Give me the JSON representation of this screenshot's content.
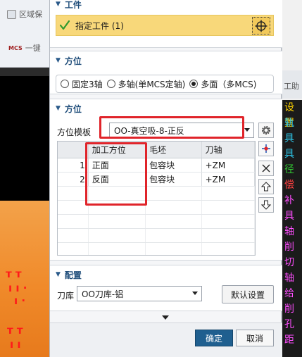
{
  "background": {
    "toolbar_item_1": "区域保",
    "toolbar_item_2_tag": "MCS",
    "toolbar_item_2": "一键",
    "right_tab": "工助",
    "right_list": [
      {
        "text": "设置",
        "color": "#ffd400"
      },
      {
        "text": "轨",
        "color": "#2ec4e6"
      },
      {
        "text": "具",
        "color": "#2ec4e6"
      },
      {
        "text": "具",
        "color": "#2ec4e6"
      },
      {
        "text": "径",
        "color": "#33cc33"
      },
      {
        "text": "偿",
        "color": "#ff4040"
      },
      {
        "text": "补",
        "color": "#ff4dff"
      },
      {
        "text": "具",
        "color": "#ff4dff"
      },
      {
        "text": "轴",
        "color": "#ff4dff"
      },
      {
        "text": "削",
        "color": "#ff4dff"
      },
      {
        "text": "切",
        "color": "#ff4dff"
      },
      {
        "text": "轴",
        "color": "#ff4dff"
      },
      {
        "text": "给",
        "color": "#ff4dff"
      },
      {
        "text": "削",
        "color": "#ff4dff"
      },
      {
        "text": "孔",
        "color": "#ff4dff"
      },
      {
        "text": "距",
        "color": "#ff4dff"
      }
    ]
  },
  "dialog": {
    "workpiece_section": {
      "title": "工件",
      "specify_label": "指定工件 (1)"
    },
    "orientation_section": {
      "title": "方位",
      "options": [
        "固定3轴",
        "多轴(单MCS定轴)",
        "多面（多MCS)"
      ],
      "selected_index": 2
    },
    "orientation2_section": {
      "title": "方位",
      "template_label": "方位模板",
      "template_value": "OO-真空吸-8-正反",
      "columns": [
        "",
        "加工方位",
        "毛坯",
        "刀轴"
      ],
      "rows": [
        {
          "index": "1",
          "direction": "正面",
          "blank": "包容块",
          "axis": "+ZM"
        },
        {
          "index": "2",
          "direction": "反面",
          "blank": "包容块",
          "axis": "+ZM"
        }
      ]
    },
    "config_section": {
      "title": "配置",
      "tool_library_label": "刀库",
      "tool_library_value": "OO刀库-铝",
      "default_button": "默认设置"
    },
    "ok_button": "确定",
    "cancel_button": "取消"
  },
  "icons": {
    "check": "check-icon",
    "crosshair": "crosshair-icon",
    "gear": "gear-icon",
    "add": "add-point-icon",
    "delete": "delete-icon",
    "up": "move-up-icon",
    "down": "move-down-icon"
  },
  "colors": {
    "highlight_row": "#f8d87a",
    "primary_button": "#1f5f8f",
    "section_title": "#1f4d7a",
    "annotation_red": "#e0242a"
  }
}
